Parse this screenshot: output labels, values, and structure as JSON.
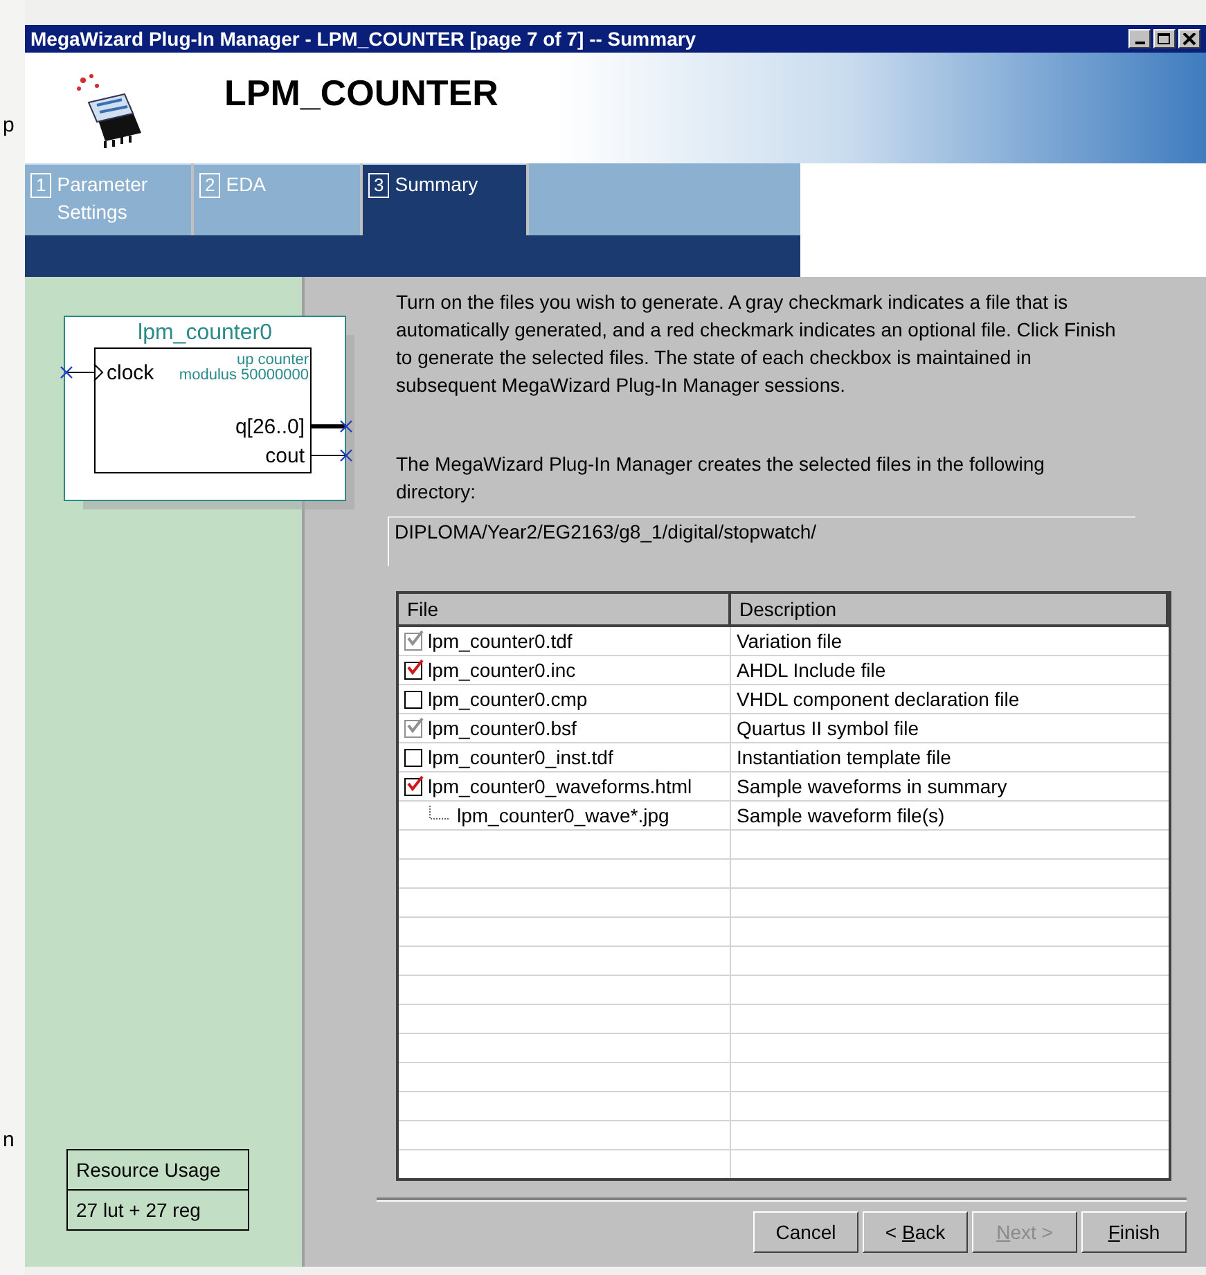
{
  "background_fragments": [
    "p",
    "n"
  ],
  "window": {
    "title": "MegaWizard Plug-In Manager - LPM_COUNTER [page 7 of 7] -- Summary"
  },
  "header": {
    "title": "LPM_COUNTER"
  },
  "tabs": [
    {
      "number": "1",
      "label": "Parameter Settings",
      "selected": false
    },
    {
      "number": "2",
      "label": "EDA",
      "selected": false
    },
    {
      "number": "3",
      "label": "Summary",
      "selected": true
    }
  ],
  "symbol": {
    "name": "lpm_counter0",
    "type": "up counter",
    "parameter": "modulus 50000000",
    "inputs": [
      "clock"
    ],
    "outputs": [
      {
        "label": "q[26..0]",
        "bus": true
      },
      {
        "label": "cout",
        "bus": false
      }
    ]
  },
  "resource_usage": {
    "heading": "Resource Usage",
    "value": "27 lut + 27 reg"
  },
  "intro": "Turn on the files you wish to generate. A gray checkmark indicates a file that is automatically generated, and a red checkmark indicates an optional file. Click Finish to generate the selected files. The state of each checkbox is maintained in subsequent MegaWizard Plug-In Manager sessions.",
  "directory_label": "The MegaWizard Plug-In Manager creates the selected files in the following directory:",
  "directory": "DIPLOMA/Year2/EG2163/g8_1/digital/stopwatch/",
  "table": {
    "columns": [
      "File",
      "Description"
    ],
    "rows": [
      {
        "file": "lpm_counter0.tdf",
        "description": "Variation file",
        "checked": true,
        "disabled": true
      },
      {
        "file": "lpm_counter0.inc",
        "description": "AHDL Include file",
        "checked": true,
        "disabled": false
      },
      {
        "file": "lpm_counter0.cmp",
        "description": "VHDL component declaration file",
        "checked": false,
        "disabled": false
      },
      {
        "file": "lpm_counter0.bsf",
        "description": "Quartus II symbol file",
        "checked": true,
        "disabled": true
      },
      {
        "file": "lpm_counter0_inst.tdf",
        "description": "Instantiation template file",
        "checked": false,
        "disabled": false
      },
      {
        "file": "lpm_counter0_waveforms.html",
        "description": "Sample waveforms in summary",
        "checked": true,
        "disabled": false,
        "children": [
          {
            "file": "lpm_counter0_wave*.jpg",
            "description": "Sample waveform file(s)"
          }
        ]
      }
    ]
  },
  "buttons": [
    {
      "before": "Cancel",
      "disabled": false
    },
    {
      "before": "< ",
      "key": "B",
      "after": "ack",
      "disabled": false
    },
    {
      "key": "N",
      "after": "ext >",
      "disabled": true
    },
    {
      "key": "F",
      "after": "inish",
      "disabled": false
    }
  ]
}
